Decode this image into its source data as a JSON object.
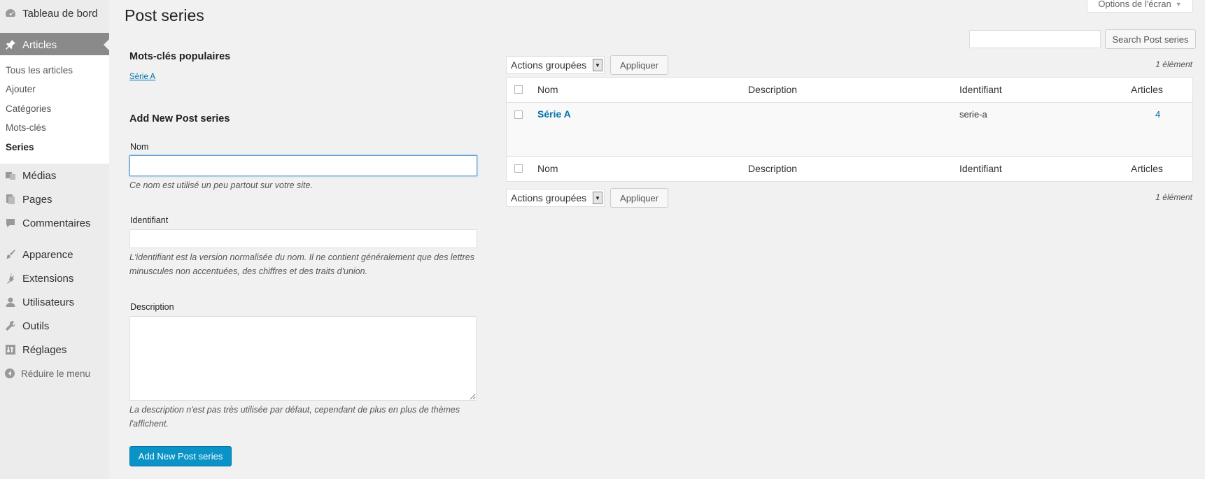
{
  "sidebar": {
    "dashboard": "Tableau de bord",
    "articles": "Articles",
    "submenu": [
      "Tous les articles",
      "Ajouter",
      "Catégories",
      "Mots-clés",
      "Series"
    ],
    "medias": "Médias",
    "pages": "Pages",
    "comments": "Commentaires",
    "appearance": "Apparence",
    "extensions": "Extensions",
    "users": "Utilisateurs",
    "tools": "Outils",
    "settings": "Réglages",
    "collapse": "Réduire le menu"
  },
  "header": {
    "title": "Post series",
    "screen_options": "Options de l'écran"
  },
  "search": {
    "value": "",
    "button": "Search Post series"
  },
  "popular": {
    "title": "Mots-clés populaires",
    "tags": [
      "Série A"
    ]
  },
  "form": {
    "title": "Add New Post series",
    "name_label": "Nom",
    "name_help": "Ce nom est utilisé un peu partout sur votre site.",
    "slug_label": "Identifiant",
    "slug_help_1": "L'identifiant est la version normalisée du nom. Il ne contient généralement que des lettres",
    "slug_help_2": "minuscules non accentuées, des chiffres et des traits d'union.",
    "desc_label": "Description",
    "desc_help_1": "La description n'est pas très utilisée par défaut, cependant de plus en plus de thèmes",
    "desc_help_2": "l'affichent.",
    "submit": "Add New Post series"
  },
  "bulk": {
    "label": "Actions groupées",
    "apply": "Appliquer",
    "count": "1 élément"
  },
  "table": {
    "columns": [
      "Nom",
      "Description",
      "Identifiant",
      "Articles"
    ],
    "rows": [
      {
        "name": "Série A",
        "description": "",
        "slug": "serie-a",
        "count": "4"
      }
    ]
  },
  "colors": {
    "accent": "#0073aa",
    "primary_button": "#0a93c7",
    "sidebar_active": "#8a8a8a"
  }
}
